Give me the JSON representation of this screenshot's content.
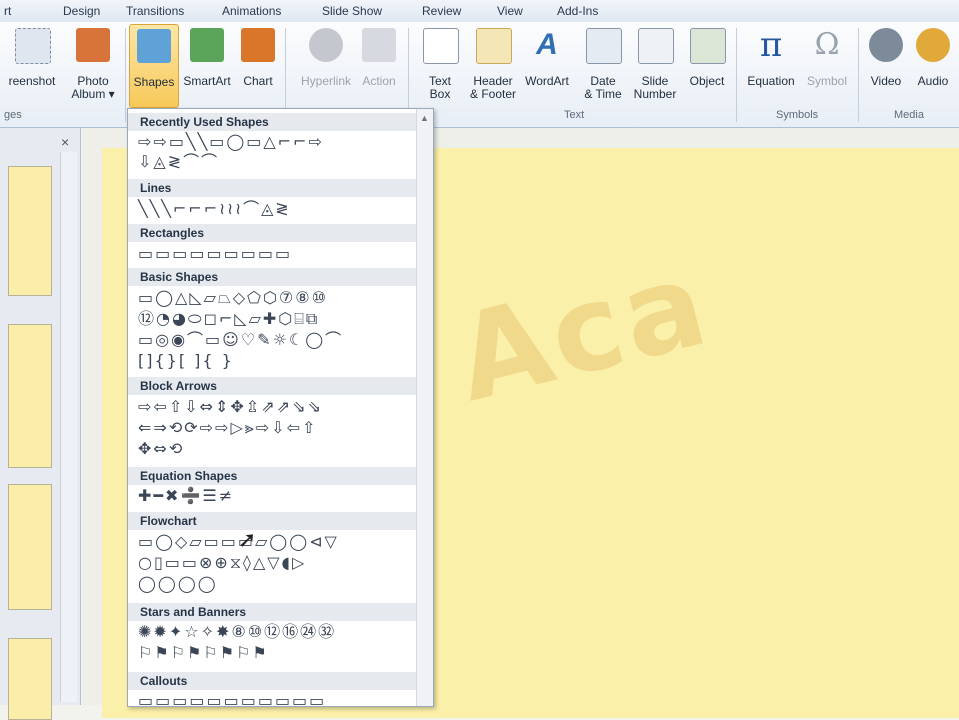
{
  "tabs": {
    "t0": "rt",
    "t1": "Design",
    "t2": "Transitions",
    "t3": "Animations",
    "t4": "Slide Show",
    "t5": "Review",
    "t6": "View",
    "t7": "Add-Ins"
  },
  "ribbon": {
    "screenshot": "reenshot",
    "photo_album": "Photo\nAlbum ▾",
    "shapes": "Shapes",
    "smartart": "SmartArt",
    "chart": "Chart",
    "hyperlink": "Hyperlink",
    "action": "Action",
    "textbox": "Text\nBox",
    "header_footer": "Header\n& Footer",
    "wordart": "WordArt",
    "date_time": "Date\n& Time",
    "slide_number": "Slide\nNumber",
    "object": "Object",
    "equation": "Equation",
    "symbol": "Symbol",
    "video": "Video",
    "audio": "Audio",
    "group_images": "ges",
    "group_text": "Text",
    "group_symbols": "Symbols",
    "group_media": "Media"
  },
  "thumbnail_pane": {
    "close": "×"
  },
  "gallery": {
    "recently_used": "Recently Used Shapes",
    "lines": "Lines",
    "rectangles": "Rectangles",
    "basic_shapes": "Basic Shapes",
    "block_arrows": "Block Arrows",
    "equation_shapes": "Equation Shapes",
    "flowchart": "Flowchart",
    "stars_banners": "Stars and Banners",
    "callouts": "Callouts",
    "rows": {
      "recent1": "⇨⇨▭╲╲▭◯▭△⌐⌐⇨",
      "recent2": "⇩◬≷⌒⌒",
      "lines1": "╲╲╲⌐⌐⌐≀≀≀⌒◬≷",
      "rect1": "▭▭▭▭▭▭▭▭▭",
      "basic1": "▭◯△◺▱⏢◇⬠⬡⑦⑧⑩",
      "basic2": "⑫◔◕⬭◻⌐◺▱✚⬡⌸⧉",
      "basic3": "▭◎◉⌒▭☺♡✎☼☾◯⌒",
      "basic4": "[]{}[ ]{ }",
      "block1": "⇨⇦⇧⇩⇔⇕✥⇫⇗⇗⇘⇘",
      "block2": "⇐⇒⟲⟳⇨⇨▷⪢⇨⇩⇦⇧",
      "block3": "✥⇔⟲",
      "eq1": "✚━✖➗☰≠",
      "flow1": "▭◯◇▱▭▭▭▱◯◯⊲▽",
      "flow2": "○▯▭▭⊗⊕⧖◊△▽◖▷",
      "flow3": "◯◯◯◯",
      "stars1": "✺✹✦☆✧✸⑧⑩⑫⑯㉔㉜",
      "stars2": "⚐⚑⚐⚑⚐⚑⚐⚑",
      "callouts1": "▭▭▭▭▭▭▭▭▭▭▭"
    }
  },
  "slide": {
    "watermark": "eq Aca"
  }
}
